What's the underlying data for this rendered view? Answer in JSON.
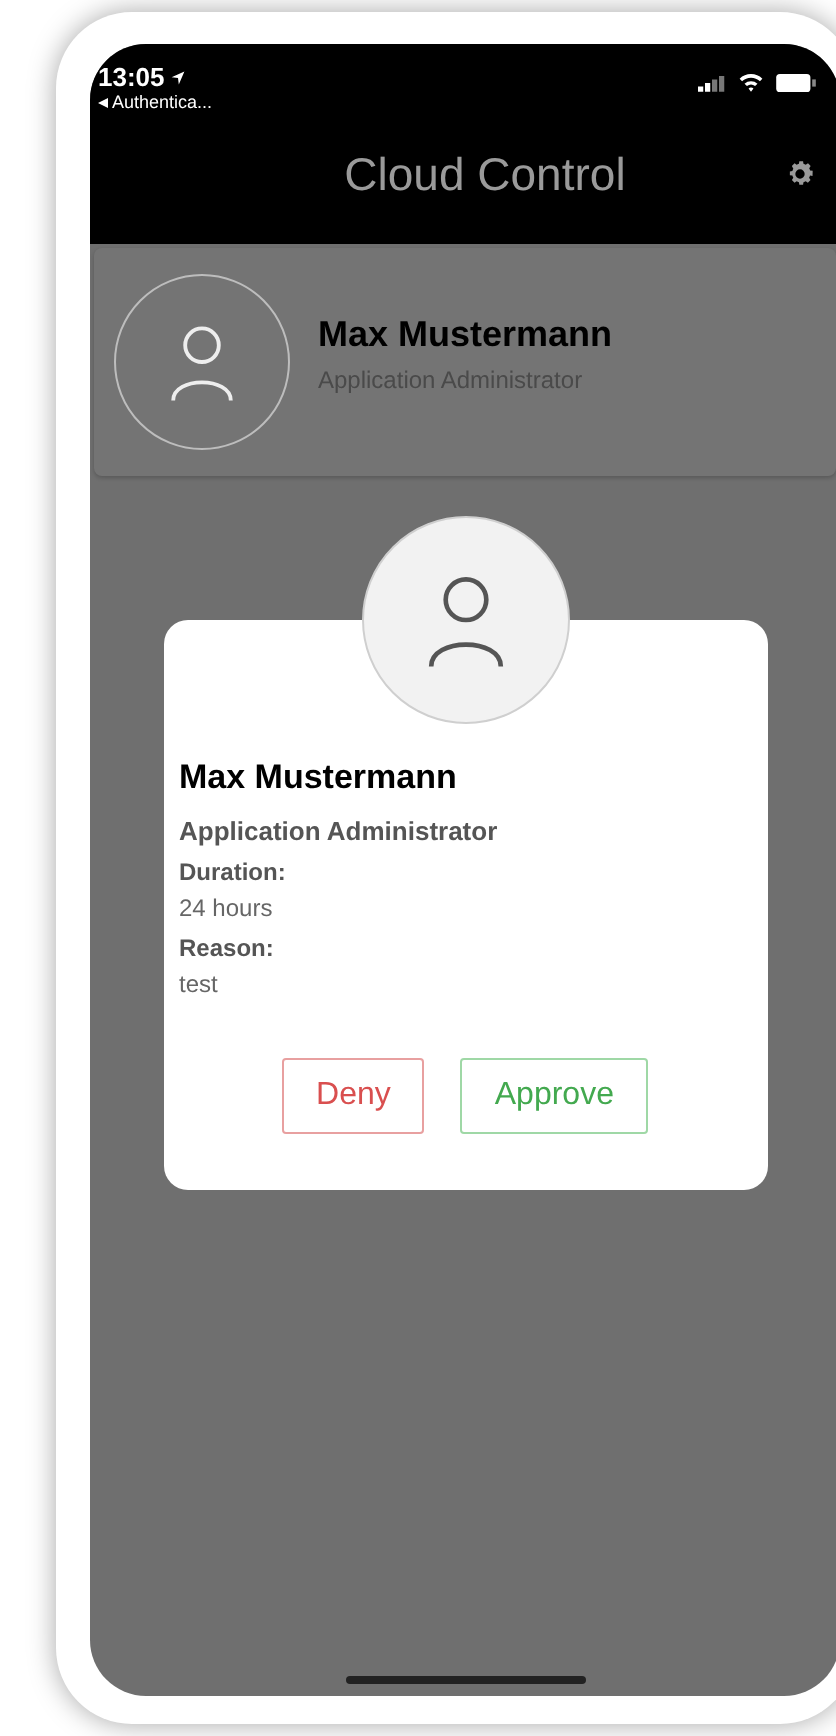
{
  "status_bar": {
    "time": "13:05",
    "back_label": "Authentica..."
  },
  "nav_bar": {
    "title": "Cloud Control"
  },
  "profile": {
    "name": "Max Mustermann",
    "role": "Application Administrator"
  },
  "request": {
    "name": "Max Mustermann",
    "role": "Application Administrator",
    "fields": [
      {
        "label": "Duration:",
        "value": "24 hours"
      },
      {
        "label": "Reason:",
        "value": "test"
      }
    ],
    "buttons": [
      {
        "label": "Deny",
        "kind": "deny"
      },
      {
        "label": "Approve",
        "kind": "approve"
      }
    ]
  }
}
